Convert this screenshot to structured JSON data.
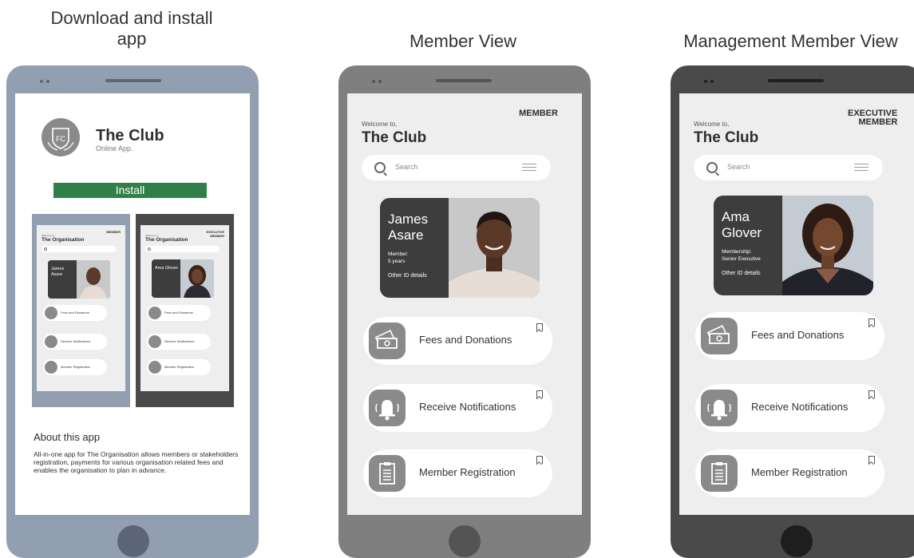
{
  "captions": {
    "download": "Download and install app",
    "member": "Member View",
    "management": "Management Member View"
  },
  "download": {
    "logo_text": "FC",
    "app_name": "The Club",
    "app_sub": "Online App.",
    "install_label": "Install",
    "about_heading": "About this app",
    "about_text": "All-in-one app for The Organisation allows members or stakeholders registration, payments for various organisation related fees and enables the organisation to plan in advance.",
    "thumb_member": {
      "badge": "MEMBER",
      "welcome": "Welcome to,",
      "title": "The Organisation",
      "search": "Search",
      "name": "James Asare",
      "rows": [
        "Fees and Donations",
        "Receive Notifications",
        "Member Registration"
      ]
    },
    "thumb_exec": {
      "badge": "EXECUTIVE MEMBER",
      "welcome": "Welcome to,",
      "title": "The Organisation",
      "search": "Search",
      "name": "Ama Glover",
      "rows": [
        "Fees and Donations",
        "Receive Notifications",
        "Member Registration"
      ]
    }
  },
  "member": {
    "badge": "MEMBER",
    "welcome": "Welcome to,",
    "title": "The Club",
    "search_placeholder": "Search",
    "card": {
      "name_line1": "James",
      "name_line2": "Asare",
      "meta_line1": "Member:",
      "meta_line2": "5 years",
      "link": "Other ID details"
    },
    "rows": [
      {
        "label": "Fees and Donations",
        "icon": "money-icon"
      },
      {
        "label": "Receive Notifications",
        "icon": "bell-icon"
      },
      {
        "label": "Member Registration",
        "icon": "clipboard-icon"
      }
    ]
  },
  "management": {
    "badge_line1": "EXECUTIVE",
    "badge_line2": "MEMBER",
    "welcome": "Welcome to,",
    "title": "The Club",
    "search_placeholder": "Search",
    "card": {
      "name_line1": "Ama",
      "name_line2": "Glover",
      "meta_line1": "Membership:",
      "meta_line2": "Senior Executive",
      "link": "Other ID details"
    },
    "rows": [
      {
        "label": "Fees and Donations",
        "icon": "money-icon"
      },
      {
        "label": "Receive Notifications",
        "icon": "bell-icon"
      },
      {
        "label": "Member Registration",
        "icon": "clipboard-icon"
      }
    ]
  },
  "colors": {
    "install_green": "#2f7f48",
    "card_dark": "#3d3d3d",
    "phone1": "#929fb0",
    "phone2": "#7f7f7f",
    "phone3": "#4a4a4a"
  }
}
